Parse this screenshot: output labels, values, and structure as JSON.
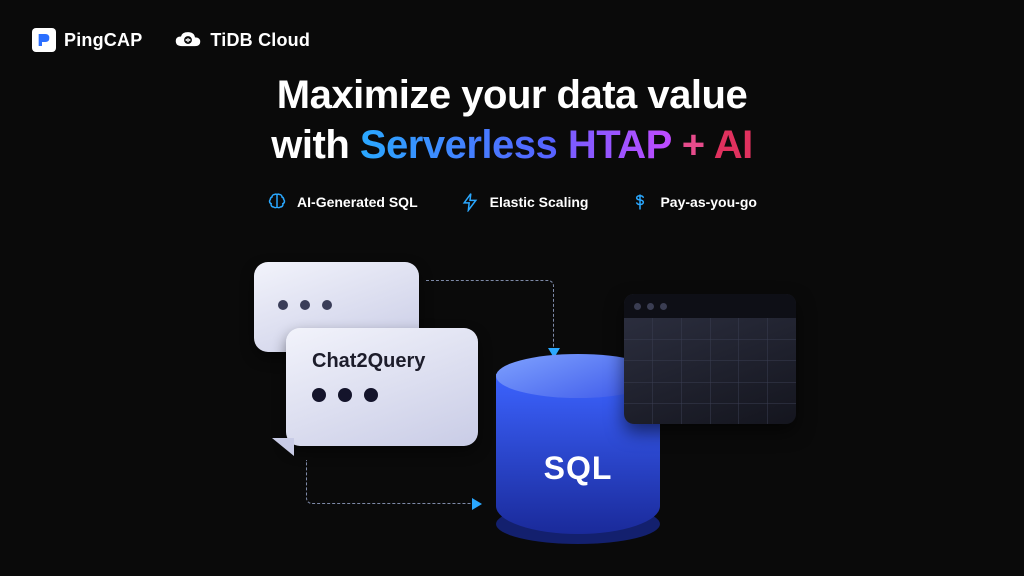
{
  "header": {
    "brand1": "PingCAP",
    "brand2": "TiDB Cloud"
  },
  "hero": {
    "line1": "Maximize your data value",
    "line2_prefix": "with ",
    "serverless": "Serverless",
    "htap": "HTAP",
    "plus": " + ",
    "ai": "AI"
  },
  "features": {
    "f1": "AI-Generated SQL",
    "f2": "Elastic Scaling",
    "f3": "Pay-as-you-go"
  },
  "diagram": {
    "chat_label": "Chat2Query",
    "db_label": "SQL"
  },
  "colors": {
    "accent_blue": "#2aa8ff"
  }
}
